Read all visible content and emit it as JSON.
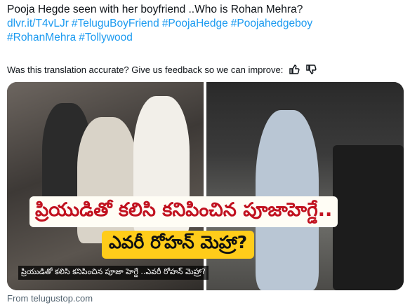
{
  "tweet": {
    "line1": "Pooja Hegde seen with her boyfriend ..Who is Rohan Mehra?",
    "link": "dlvr.it/T4vLJr",
    "hashtags": [
      "#TeluguBoyFriend",
      "#PoojaHedge",
      "#Poojahedgeboy",
      "#RohanMehra",
      "#Tollywood"
    ]
  },
  "feedback": {
    "question": "Was this translation accurate? Give us feedback so we can improve:",
    "icons": [
      "thumbs-up-icon",
      "thumbs-down-icon"
    ]
  },
  "media": {
    "headline_line1": "ప్రియుడితో కలిసి కనిపించిన పూజాహెగ్డే..",
    "headline_line2": "ఎవరీ రోహన్ మెహ్రా?",
    "caption": "ప్రియుడితో కలిసి కనిపించిన పూజా హెగ్డే ..ఎవరీ రోహన్ మెహ్రా?"
  },
  "card_source": "From telugustop.com",
  "colors": {
    "link": "#1d9bf0",
    "headline_red": "#c1121f",
    "headline_yellow": "#ffcc1a",
    "muted": "#536471"
  }
}
